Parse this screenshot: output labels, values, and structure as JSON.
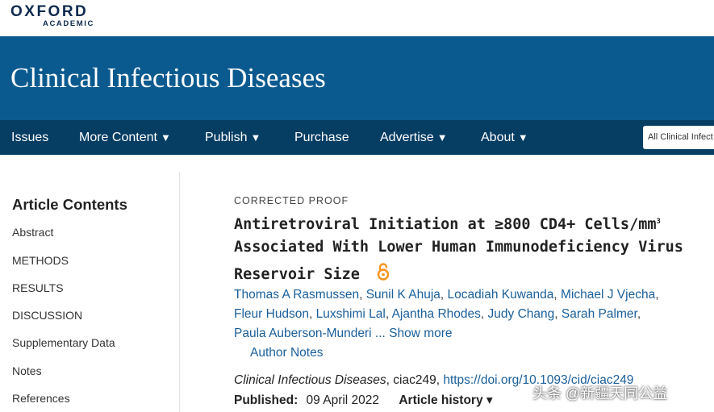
{
  "publisher": {
    "logo_main": "OXFORD",
    "logo_sub": "ACADEMIC"
  },
  "journal": {
    "title": "Clinical Infectious Diseases"
  },
  "nav": {
    "items": [
      {
        "label": "Issues",
        "has_caret": false
      },
      {
        "label": "More Content",
        "has_caret": true
      },
      {
        "label": "Publish",
        "has_caret": true
      },
      {
        "label": "Purchase",
        "has_caret": false
      },
      {
        "label": "Advertise",
        "has_caret": true
      },
      {
        "label": "About",
        "has_caret": true
      }
    ],
    "caret": "▼",
    "search_scope": "All Clinical Infect"
  },
  "sidebar": {
    "heading": "Article Contents",
    "items": [
      "Abstract",
      "METHODS",
      "RESULTS",
      "DISCUSSION",
      "Supplementary Data",
      "Notes",
      "References"
    ]
  },
  "article": {
    "label": "CORRECTED PROOF",
    "title_line1": "Antiretroviral Initiation at ≥800 CD4+ Cells/mm",
    "title_sup": "3",
    "title_line2": "Associated With Lower Human Immunodeficiency Virus",
    "title_line3": "Reservoir Size",
    "authors": [
      "Thomas A Rasmussen",
      "Sunil K Ahuja",
      "Locadiah Kuwanda",
      "Michael J Vjecha",
      "Fleur Hudson",
      "Luxshimi Lal",
      "Ajantha Rhodes",
      "Judy Chang",
      "Sarah Palmer",
      "Paula Auberson-Munderi"
    ],
    "ellipsis": "...",
    "show_more": "Show more",
    "author_notes": "Author Notes",
    "citation_journal": "Clinical Infectious Diseases",
    "citation_id": ", ciac249, ",
    "doi": "https://doi.org/10.1093/cid/ciac249",
    "published_label": "Published:",
    "published_date": "09 April 2022",
    "history_label": "Article history",
    "history_caret": "▾"
  },
  "watermark": "头条 @新疆天同公益",
  "colors": {
    "banner": "#0a5a8f",
    "navbar": "#063d63",
    "link": "#1a5f9a",
    "open_access": "#f7931e"
  },
  "icons": {
    "open_access": "open-access-lock-icon"
  }
}
